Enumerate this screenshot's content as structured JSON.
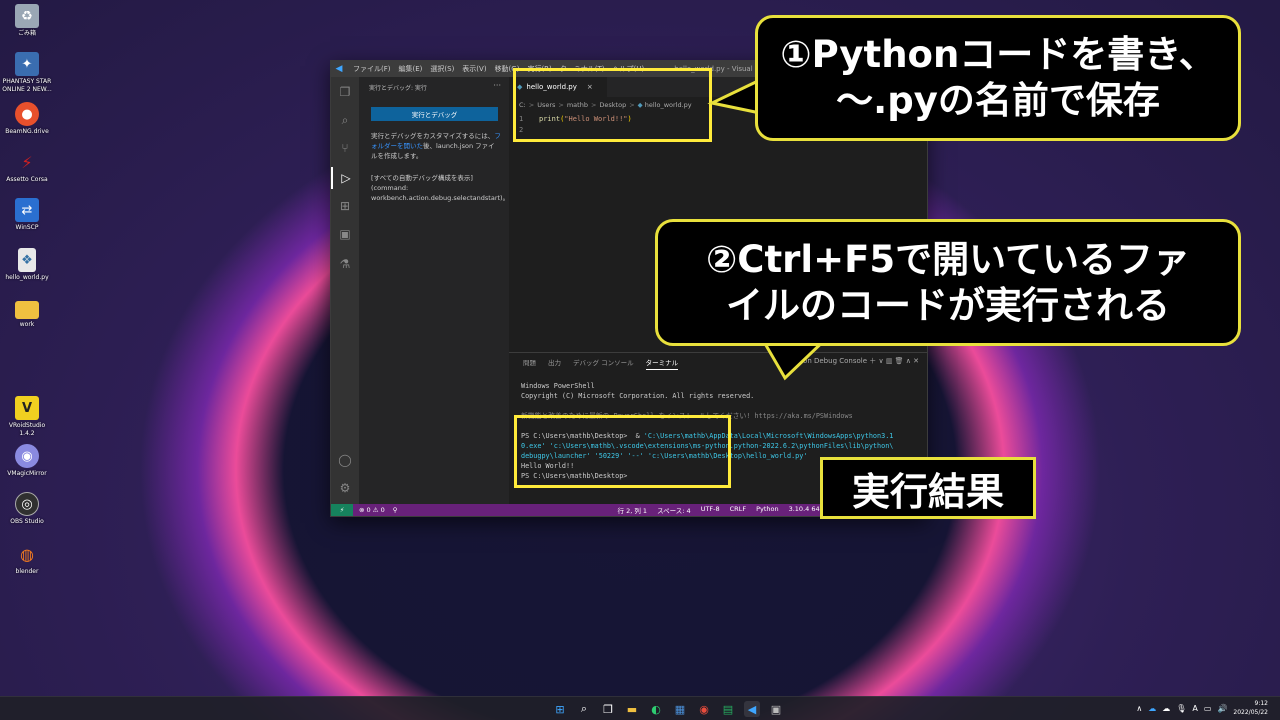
{
  "desktop": {
    "icons": [
      {
        "label": "ごみ箱",
        "icon": "recycle-bin-icon",
        "color": "#d0d8e0"
      },
      {
        "label": "PHANTASY STAR ONLINE 2 NEW...",
        "icon": "pso2-icon",
        "color": "#3a6db0"
      },
      {
        "label": "BeamNG.drive",
        "icon": "beamng-icon",
        "color": "#e8502c"
      },
      {
        "label": "Assetto Corsa",
        "icon": "assetto-corsa-icon",
        "color": "#c02020"
      },
      {
        "label": "WinSCP",
        "icon": "winscp-icon",
        "color": "#2a6fd0"
      },
      {
        "label": "hello_world.py",
        "icon": "python-file-icon",
        "color": "#e0e0e0"
      },
      {
        "label": "work",
        "icon": "folder-icon",
        "color": "#f0c040"
      },
      {
        "label": "VRoidStudio 1.4.2",
        "icon": "vroid-icon",
        "color": "#f0d020"
      },
      {
        "label": "VMagicMirror",
        "icon": "vmagicmirror-icon",
        "color": "#6a6ad0"
      },
      {
        "label": "OBS Studio",
        "icon": "obs-icon",
        "color": "#303030"
      },
      {
        "label": "blender",
        "icon": "blender-icon",
        "color": "#f07a20"
      }
    ]
  },
  "vscode": {
    "menu": [
      "ファイル(F)",
      "編集(E)",
      "選択(S)",
      "表示(V)",
      "移動(G)",
      "実行(R)",
      "ターミナル(T)",
      "ヘルプ(H)"
    ],
    "title": "hello_world.py - Visual Studio Code",
    "sidebar": {
      "header": "実行とデバッグ: 実行",
      "more": "···",
      "run_button": "実行とデバッグ",
      "desc_before": "実行とデバッグをカスタマイズするには、",
      "desc_link": "フォルダーを開いた",
      "desc_after": "後、launch.json ファイルを作成します。",
      "auto_config_1": "[すべての自動デバッグ構成を表示]",
      "auto_config_2": "(command:",
      "auto_config_3": "workbench.action.debug.selectandstart)。"
    },
    "tab": {
      "label": "hello_world.py",
      "close": "×"
    },
    "breadcrumbs": [
      "C:",
      "Users",
      "mathb",
      "Desktop",
      "hello_world.py"
    ],
    "code": {
      "line1_num": "1",
      "line1_fn": "print",
      "line1_open": "(",
      "line1_str": "\"Hello World!!\"",
      "line1_close": ")",
      "line2_num": "2"
    },
    "panel": {
      "tabs": [
        "問題",
        "出力",
        "デバッグ コンソール",
        "ターミナル"
      ],
      "controls": "Python Debug Console  ＋ ∨  ▥  🗑  ∧  ✕",
      "terminal_lines": [
        "Windows PowerShell",
        "Copyright (C) Microsoft Corporation. All rights reserved.",
        "",
        "新機能と改善のために最新の PowerShell をインストールしてください! https://aka.ms/PSWindows",
        ""
      ],
      "prompt_line": "PS C:\\Users\\mathb\\Desktop>  & ",
      "cmd_line_1": "'C:\\Users\\mathb\\AppData\\Local\\Microsoft\\WindowsApps\\python3.1",
      "cmd_line_2": "0.exe' 'c:\\Users\\mathb\\.vscode\\extensions\\ms-python.python-2022.6.2\\pythonFiles\\lib\\python\\",
      "cmd_line_3": "debugpy\\launcher' '50229' '--' 'c:\\Users\\mathb\\Desktop\\hello_world.py'",
      "output": "Hello World!!",
      "final_prompt": "PS C:\\Users\\mathb\\Desktop>"
    },
    "status": {
      "errors": "⊗ 0 ⚠ 0",
      "position": "行 2, 列 1",
      "spaces": "スペース: 4",
      "encoding": "UTF-8",
      "eol": "CRLF",
      "language": "Python",
      "interpreter": "3.10.4 64-bit (windows store)"
    }
  },
  "callouts": {
    "save_line1": "①Pythonコードを書き、",
    "save_line2": "～.pyの名前で保存",
    "run_line1": "②Ctrl+F5で開いているファ",
    "run_line2": "イルのコードが実行される",
    "result": "実行結果"
  },
  "taskbar": {
    "clock_time": "9:12",
    "clock_date": "2022/05/22"
  },
  "colors": {
    "highlight": "#ffeb3b",
    "callout_border": "#e8e03c",
    "vscode_blue_button": "#0e639c",
    "statusbar": "#68217a"
  }
}
